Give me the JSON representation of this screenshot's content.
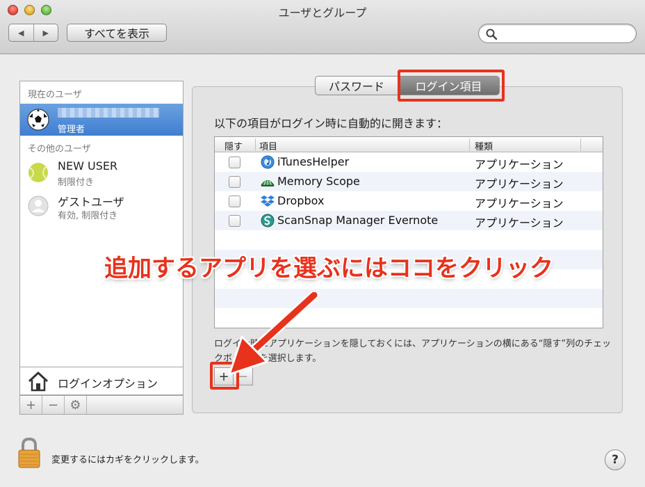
{
  "window": {
    "title": "ユーザとグループ",
    "nav_back": "◀",
    "nav_forward": "▶",
    "show_all": "すべてを表示",
    "search_value": "",
    "search_placeholder": ""
  },
  "sidebar": {
    "current_header": "現在のユーザ",
    "current_user": {
      "name": "",
      "role": "管理者",
      "icon": "soccer-ball-icon"
    },
    "others_header": "その他のユーザ",
    "others": [
      {
        "name": "NEW USER",
        "role": "制限付き",
        "icon": "tennis-ball-icon"
      },
      {
        "name": "ゲストユーザ",
        "role": "有効, 制限付き",
        "icon": "guest-user-icon"
      }
    ],
    "login_options": "ログインオプション",
    "add": "+",
    "remove": "−",
    "action": "⚙"
  },
  "tabs": [
    {
      "label": "パスワード",
      "selected": false
    },
    {
      "label": "ログイン項目",
      "selected": true
    }
  ],
  "intro_text": "以下の項目がログイン時に自動的に開きます：",
  "table": {
    "columns": [
      "隠す",
      "項目",
      "種類"
    ],
    "rows": [
      {
        "hide": false,
        "name": "iTunesHelper",
        "kind": "アプリケーション",
        "icon": "itunes-icon"
      },
      {
        "hide": false,
        "name": "Memory Scope",
        "kind": "アプリケーション",
        "icon": "memory-scope-icon"
      },
      {
        "hide": false,
        "name": "Dropbox",
        "kind": "アプリケーション",
        "icon": "dropbox-icon"
      },
      {
        "hide": false,
        "name": "ScanSnap Manager Evernote",
        "kind": "アプリケーション",
        "icon": "scansnap-icon"
      }
    ]
  },
  "help_note": "ログイン時にアプリケーションを隠しておくには、アプリケーションの横にある“隠す”列のチェックボックスを選択します。",
  "list_buttons": {
    "add": "+",
    "remove": "−"
  },
  "annotation": "追加するアプリを選ぶにはココをクリック",
  "footer": {
    "lock_text": "変更するにはカギをクリックします。",
    "help": "?"
  },
  "colors": {
    "highlight": "#e8321c",
    "selection": "#3f7ed0"
  }
}
